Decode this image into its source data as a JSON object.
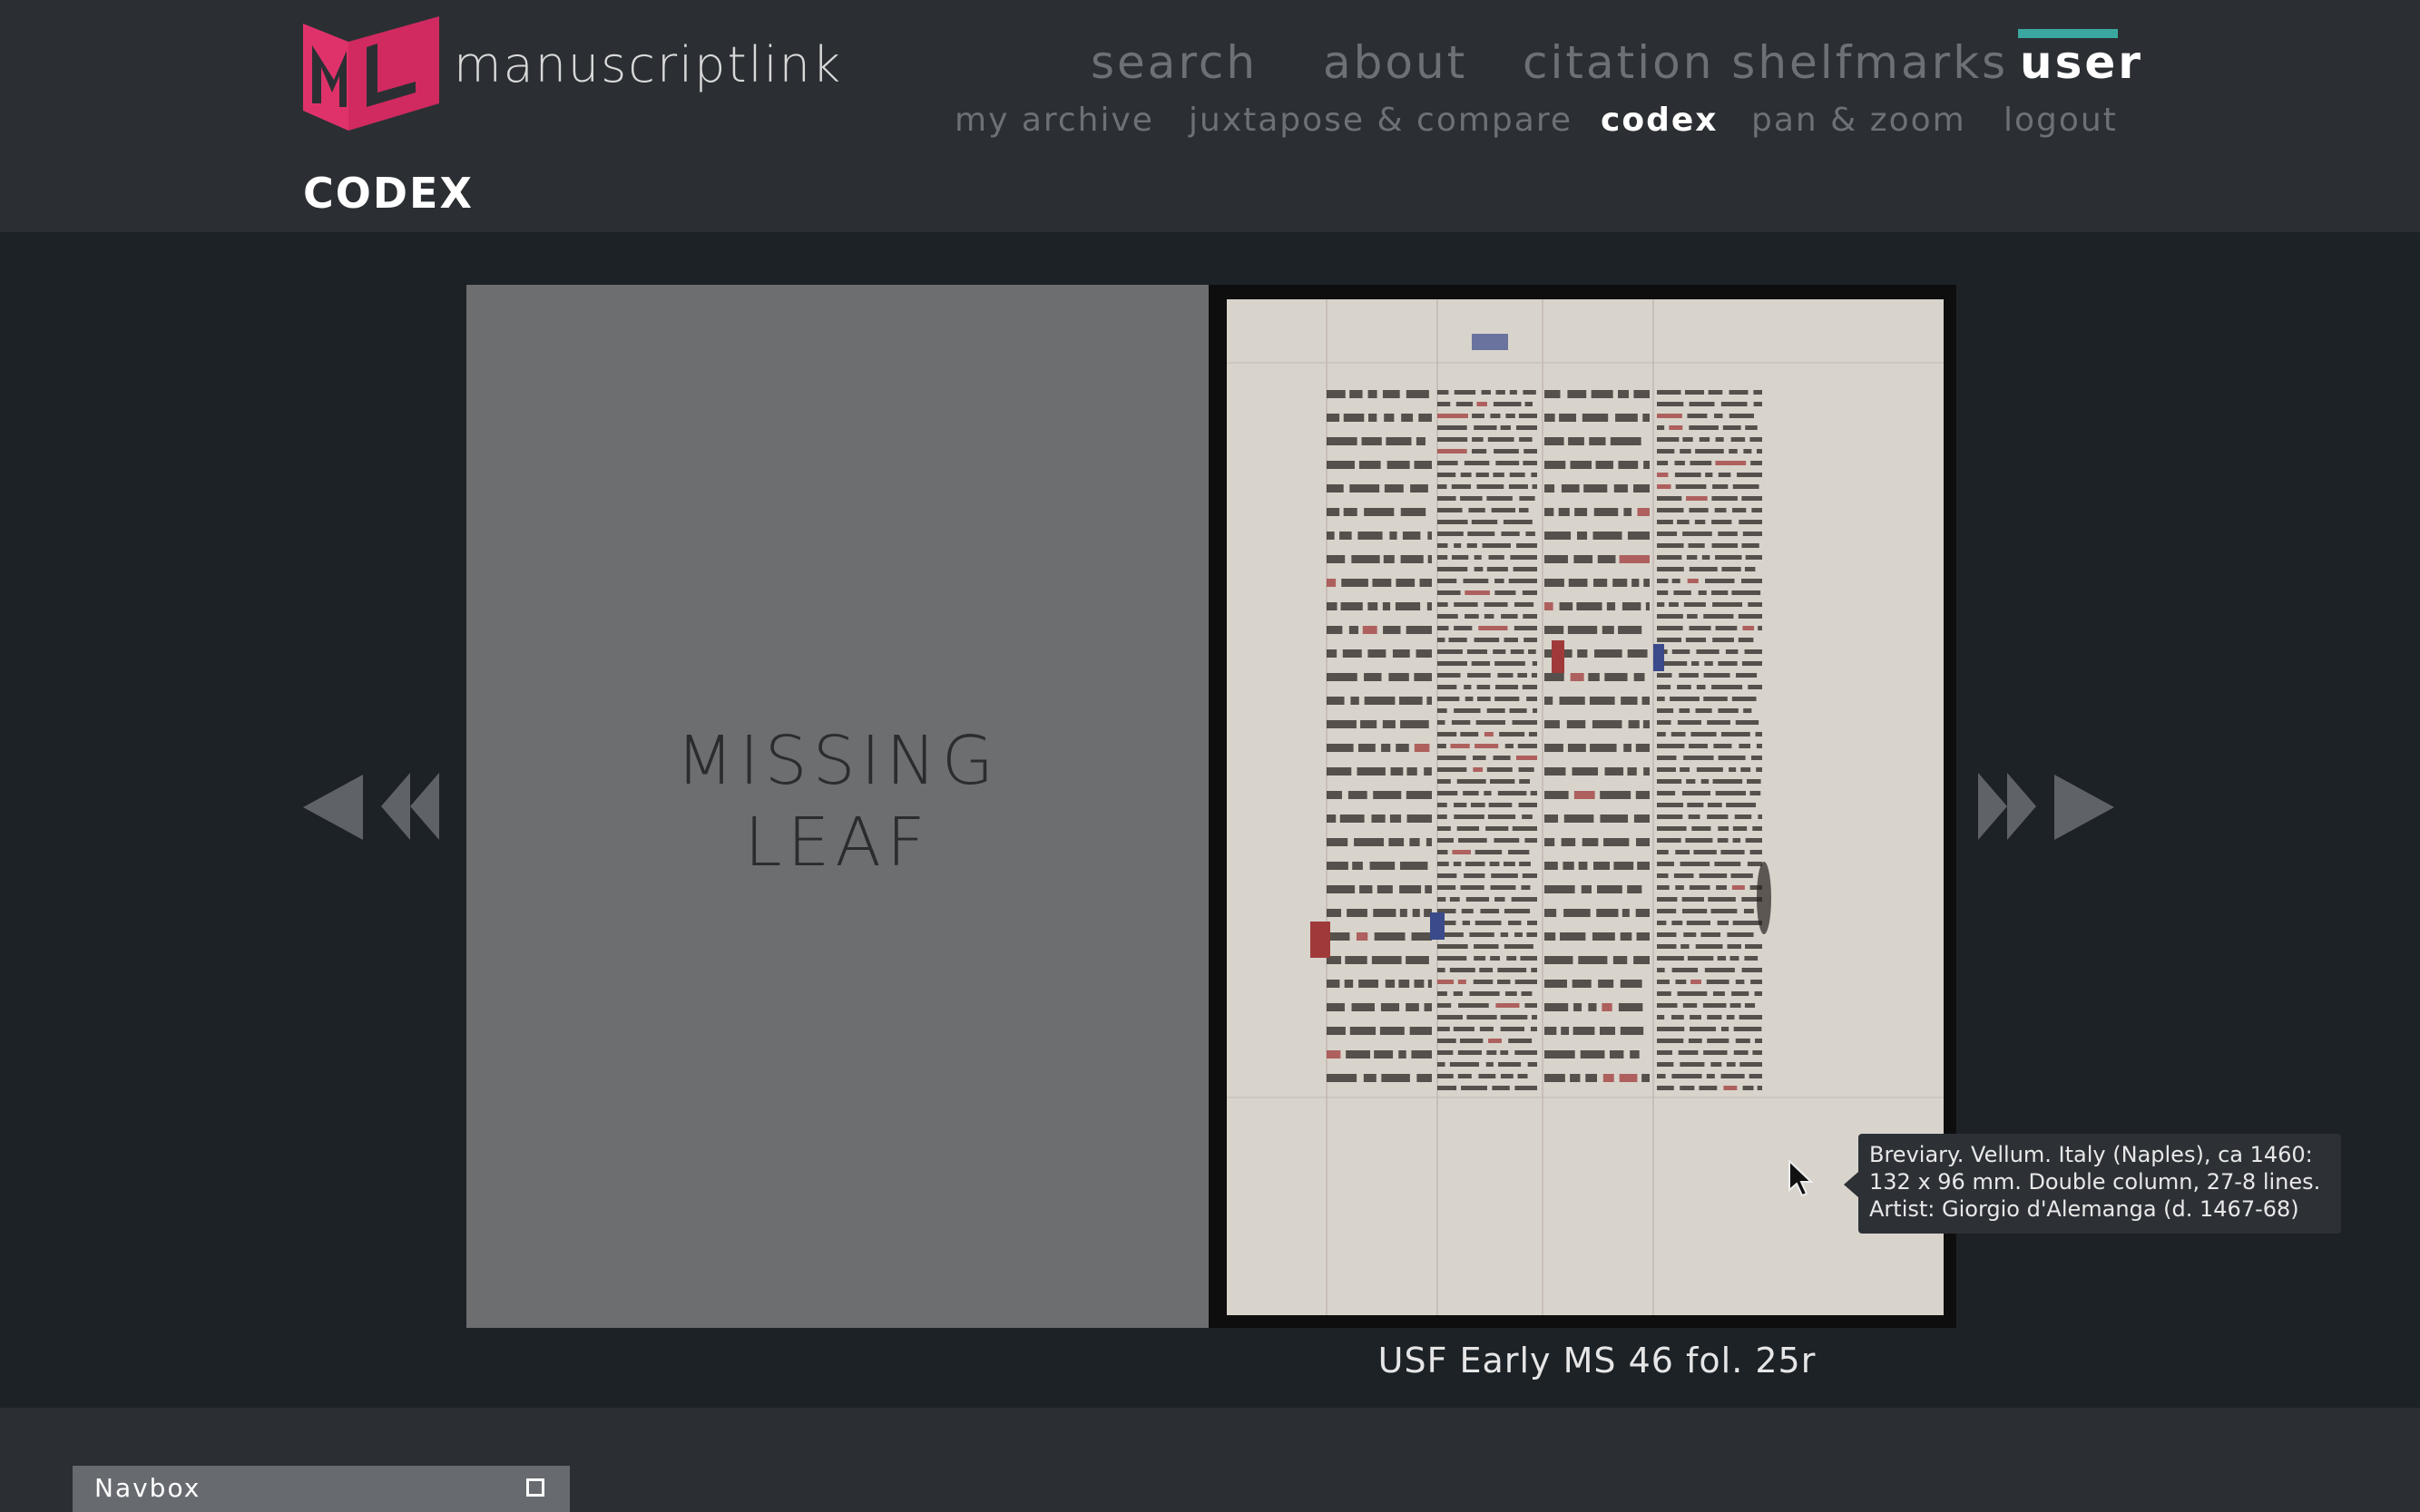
{
  "brand": {
    "logo_text": "manuscriptlink",
    "logo_color": "#e0326a"
  },
  "nav": {
    "primary": [
      "search",
      "about",
      "citation shelfmarks",
      "user"
    ],
    "active_primary": "user",
    "secondary": [
      "my archive",
      "juxtapose & compare",
      "codex",
      "pan & zoom",
      "logout"
    ],
    "active_secondary": "codex",
    "accent_color": "#3aa8a0"
  },
  "page": {
    "title": "CODEX"
  },
  "viewer": {
    "missing_leaf": [
      "MISSING",
      "LEAF"
    ],
    "folio_caption": "USF Early MS 46 fol. 25r",
    "tooltip": [
      "Breviary. Vellum. Italy (Naples), ca 1460:",
      "132 x 96 mm. Double column, 27-8 lines.",
      "Artist: Giorgio d'Alemanga (d. 1467-68)"
    ],
    "icons": {
      "prev_first": "arrow-left-icon",
      "prev": "double-arrow-left-icon",
      "next": "double-arrow-right-icon",
      "next_last": "arrow-right-icon"
    }
  },
  "footer": {
    "navbox_label": "Navbox"
  }
}
